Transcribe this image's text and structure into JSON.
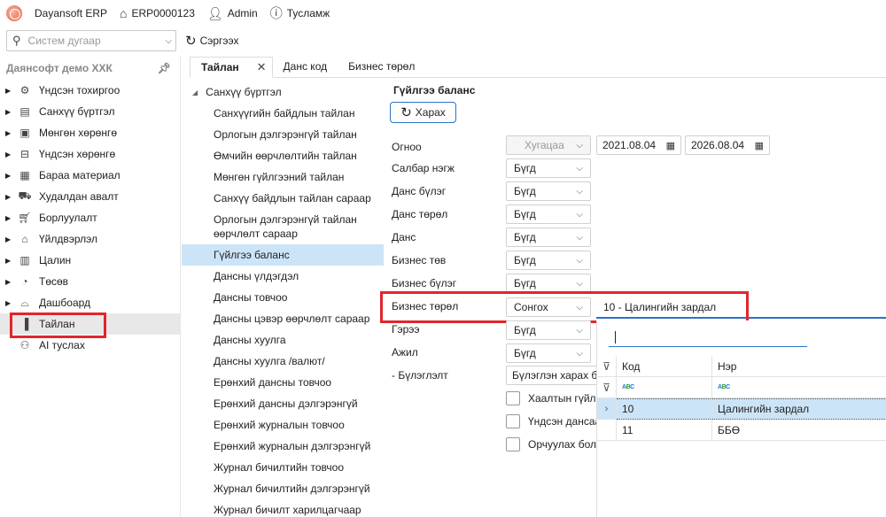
{
  "topbar": {
    "app_name": "Dayansoft ERP",
    "erp_code": "ERP0000123",
    "user": "Admin",
    "help": "Тусламж"
  },
  "toolbar": {
    "search_placeholder": "Систем дугаар",
    "refresh_label": "Сэргээх"
  },
  "sidebar": {
    "title": "Даянсофт демо ХХК",
    "items": [
      {
        "label": "Үндсэн тохиргоо",
        "icon": "gear-icon"
      },
      {
        "label": "Санхүү бүртгэл",
        "icon": "ledger-icon"
      },
      {
        "label": "Мөнгөн хөрөнгө",
        "icon": "cash-icon"
      },
      {
        "label": "Үндсэн хөрөнгө",
        "icon": "asset-icon"
      },
      {
        "label": "Бараа материал",
        "icon": "box-icon"
      },
      {
        "label": "Худалдан авалт",
        "icon": "cart-icon"
      },
      {
        "label": "Борлуулалт",
        "icon": "sales-cart-icon"
      },
      {
        "label": "Үйлдвэрлэл",
        "icon": "factory-icon"
      },
      {
        "label": "Цалин",
        "icon": "payroll-icon"
      },
      {
        "label": "Төсөв",
        "icon": "pie-chart-icon"
      },
      {
        "label": "Дашбоард",
        "icon": "dashboard-icon"
      },
      {
        "label": "Тайлан",
        "icon": "report-icon"
      },
      {
        "label": "AI туслах",
        "icon": "assistant-icon"
      }
    ]
  },
  "tabs": [
    {
      "label": "Тайлан"
    },
    {
      "label": "Данс код"
    },
    {
      "label": "Бизнес төрөл"
    }
  ],
  "reports": {
    "group": "Санхүү бүртгэл",
    "items": [
      "Санхүүгийн байдлын тайлан",
      "Орлогын дэлгэрэнгүй тайлан",
      "Өмчийн өөрчлөлтийн тайлан",
      "Мөнгөн гүйлгээний тайлан",
      "Санхүү байдлын тайлан сараар",
      "Орлогын дэлгэрэнгүй тайлан өөрчлөлт сараар",
      "Гүйлгээ баланс",
      "Дансны үлдэгдэл",
      "Дансны товчоо",
      "Дансны цэвэр өөрчлөлт сараар",
      "Дансны хуулга",
      "Дансны хуулга /валют/",
      "Ерөнхий дансны товчоо",
      "Ерөнхий дансны дэлгэрэнгүй",
      "Ерөнхий журналын товчоо",
      "Ерөнхий журналын дэлгэрэнгүй",
      "Журнал бичилтийн товчоо",
      "Журнал бичилтийн дэлгэрэнгүй",
      "Журнал бичилт харилцагчаар"
    ]
  },
  "form": {
    "title": "Гүйлгээ баланс",
    "view_label": "Харах",
    "date_label": "Огноо",
    "period_value": "Хугацаа",
    "date_from": "2021.08.04",
    "date_to": "2026.08.04",
    "filters": [
      {
        "label": "Салбар нэгж",
        "value": "Бүгд"
      },
      {
        "label": "Данс бүлэг",
        "value": "Бүгд"
      },
      {
        "label": "Данс төрөл",
        "value": "Бүгд"
      },
      {
        "label": "Данс",
        "value": "Бүгд"
      },
      {
        "label": "Бизнес төв",
        "value": "Бүгд"
      },
      {
        "label": "Бизнес бүлэг",
        "value": "Бүгд"
      },
      {
        "label": "Бизнес төрөл",
        "value": "Сонгох"
      },
      {
        "label": "Гэрээ",
        "value": "Бүгд"
      },
      {
        "label": "Ажил",
        "value": "Бүгд"
      }
    ],
    "grouping_label": "- Бүлэглэлт",
    "grouping_value": "Бүлэглэн харах бо",
    "checkboxes": [
      "Хаалтын гүйлг",
      "Үндсэн дансаа",
      "Орчуулах бол"
    ],
    "business_type_value": "10 - Цалингийн зардал"
  },
  "popup": {
    "columns": [
      "Код",
      "Нэр"
    ],
    "rows": [
      {
        "code": "10",
        "name": "Цалингийн зардал"
      },
      {
        "code": "11",
        "name": "ББӨ"
      }
    ]
  }
}
